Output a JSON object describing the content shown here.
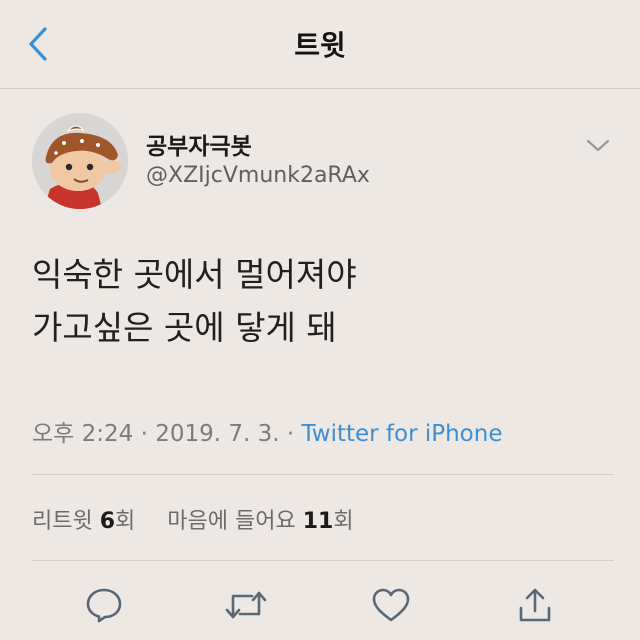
{
  "nav": {
    "title": "트윗"
  },
  "author": {
    "display_name": "공부자극봇",
    "handle": "@XZIjcVmunk2aRAx"
  },
  "tweet": {
    "lines": [
      "익숙한 곳에서 멀어져야",
      "가고싶은 곳에 닿게 돼"
    ]
  },
  "meta": {
    "time": "오후 2:24",
    "separator": "·",
    "date": "2019. 7. 3.",
    "source": "Twitter for iPhone"
  },
  "stats": {
    "retweets_label": "리트윗",
    "retweets_count": "6",
    "retweets_unit": "회",
    "likes_label": "마음에 들어요",
    "likes_count": "11",
    "likes_unit": "회"
  },
  "colors": {
    "accent": "#3d8fd2",
    "background": "#ede8e4",
    "icon": "#5a6875"
  },
  "icons": [
    "back-chevron-icon",
    "chevron-down-icon",
    "reply-icon",
    "retweet-icon",
    "like-icon",
    "share-icon"
  ]
}
